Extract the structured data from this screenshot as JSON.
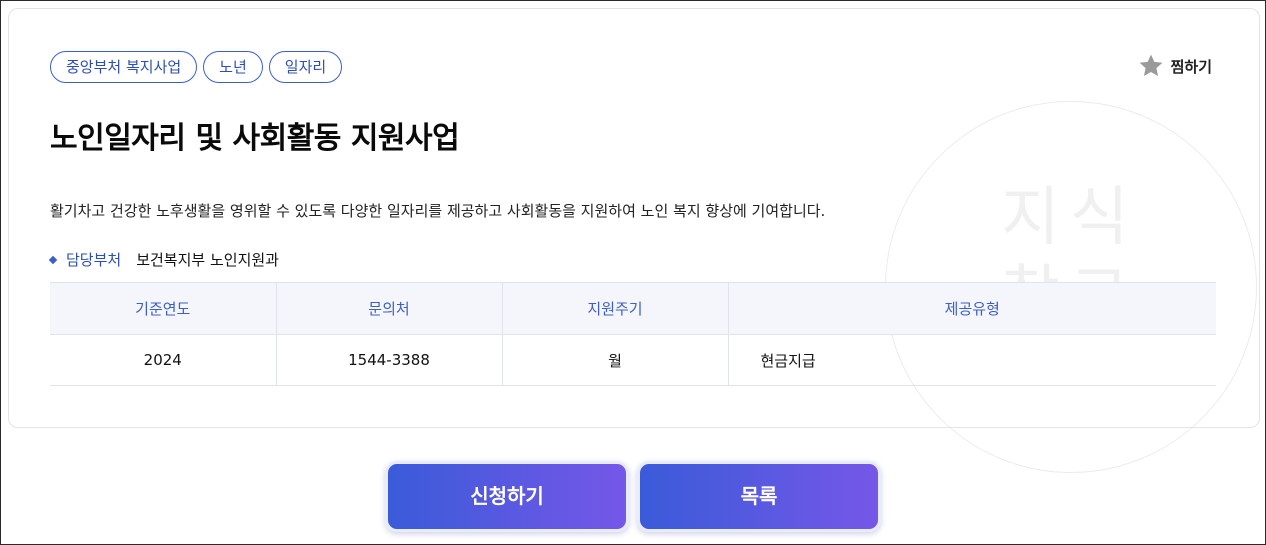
{
  "tags": [
    "중앙부처 복지사업",
    "노년",
    "일자리"
  ],
  "favorite": {
    "label": "찜하기",
    "icon": "star-icon"
  },
  "title": "노인일자리 및 사회활동 지원사업",
  "description": "활기차고 건강한 노후생활을 영위할 수 있도록 다양한 일자리를 제공하고 사회활동을 지원하여 노인 복지 향상에 기여합니다.",
  "department": {
    "label": "담당부처",
    "value": "보건복지부 노인지원과"
  },
  "table": {
    "headers": [
      "기준연도",
      "문의처",
      "지원주기",
      "제공유형"
    ],
    "row": [
      "2024",
      "1544-3388",
      "월",
      "현금지급"
    ]
  },
  "watermark": {
    "lines": [
      "지식",
      "창고"
    ]
  },
  "buttons": {
    "apply": "신청하기",
    "list": "목록"
  },
  "colors": {
    "accent": "#3a5fcd",
    "button_gradient_start": "#3a5bd9",
    "button_gradient_end": "#7657e8",
    "star": "#9a9a9a"
  }
}
